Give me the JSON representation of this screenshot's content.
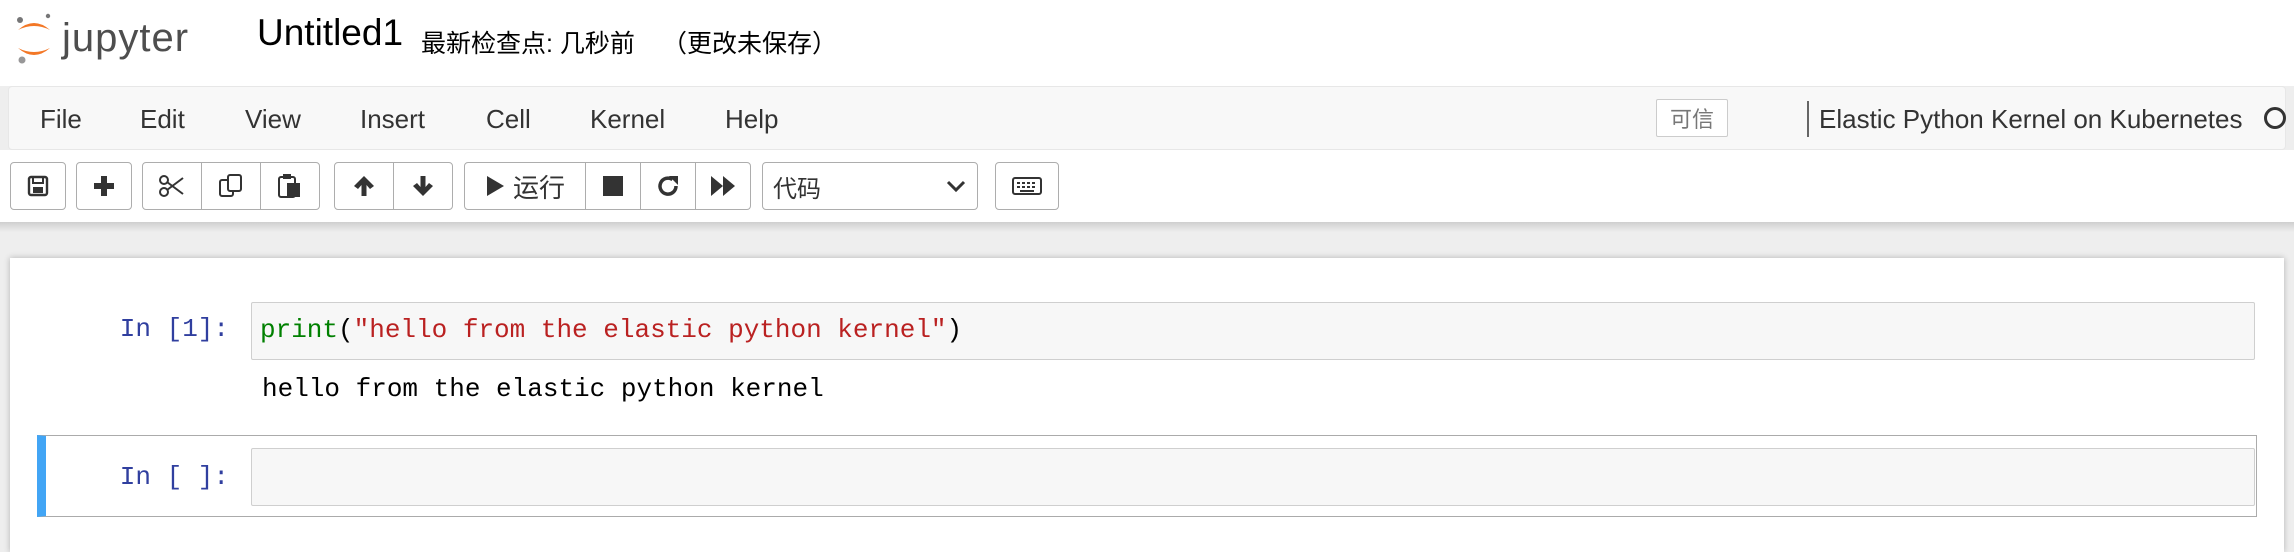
{
  "header": {
    "logo_text": "jupyter",
    "notebook_name": "Untitled1",
    "checkpoint_label": "最新检查点: 几秒前",
    "autosave_status": "（更改未保存）"
  },
  "menubar": {
    "items": [
      "File",
      "Edit",
      "View",
      "Insert",
      "Cell",
      "Kernel",
      "Help"
    ],
    "trusted_label": "可信",
    "kernel_name": "Elastic Python Kernel on Kubernetes"
  },
  "toolbar": {
    "run_label": "运行",
    "cell_type_selected": "代码",
    "icons": [
      "save-icon",
      "plus-icon",
      "cut-icon",
      "copy-icon",
      "paste-icon",
      "arrow-up-icon",
      "arrow-down-icon",
      "play-icon",
      "stop-icon",
      "restart-icon",
      "fast-forward-icon",
      "keyboard-icon"
    ]
  },
  "cells": [
    {
      "prompt": "In [1]:",
      "code": {
        "builtin": "print",
        "open_paren": "(",
        "string": "\"hello from the elastic python kernel\"",
        "close_paren": ")"
      },
      "output": "hello from the elastic python kernel"
    },
    {
      "prompt": "In [ ]:",
      "code": ""
    }
  ],
  "colors": {
    "prompt_in": "#303f9f",
    "builtin": "#008000",
    "string": "#ba2121",
    "selected_cell_bar": "#42a5f5",
    "logo_orange": "#f37726"
  }
}
